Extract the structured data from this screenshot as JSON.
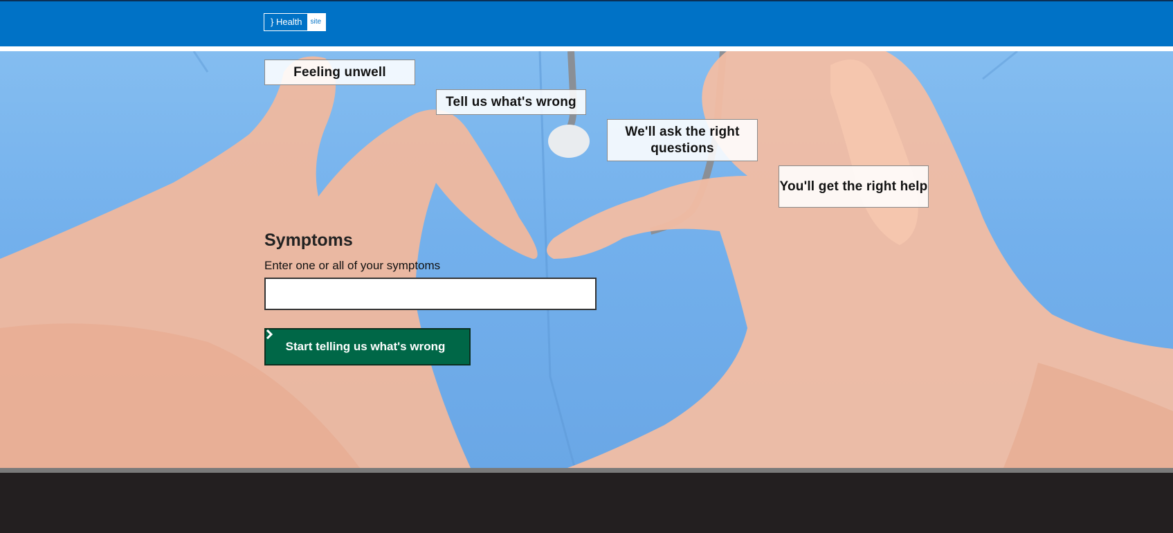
{
  "header": {
    "logo_main": "} Health",
    "logo_tag": "site"
  },
  "steps": [
    {
      "label": "Feeling unwell"
    },
    {
      "label": "Tell us what's wrong"
    },
    {
      "label": "We'll ask the right questions"
    },
    {
      "label": "You'll get the right help"
    }
  ],
  "symptoms": {
    "title": "Symptoms",
    "hint": "Enter one or all of your symptoms",
    "input_value": "",
    "start_button_label": "Start telling us what's wrong",
    "start_button_icon": "chevron-right-icon"
  },
  "colors": {
    "header_blue": "#0072c6",
    "button_green": "#006747",
    "footer_dark": "#231f20"
  }
}
